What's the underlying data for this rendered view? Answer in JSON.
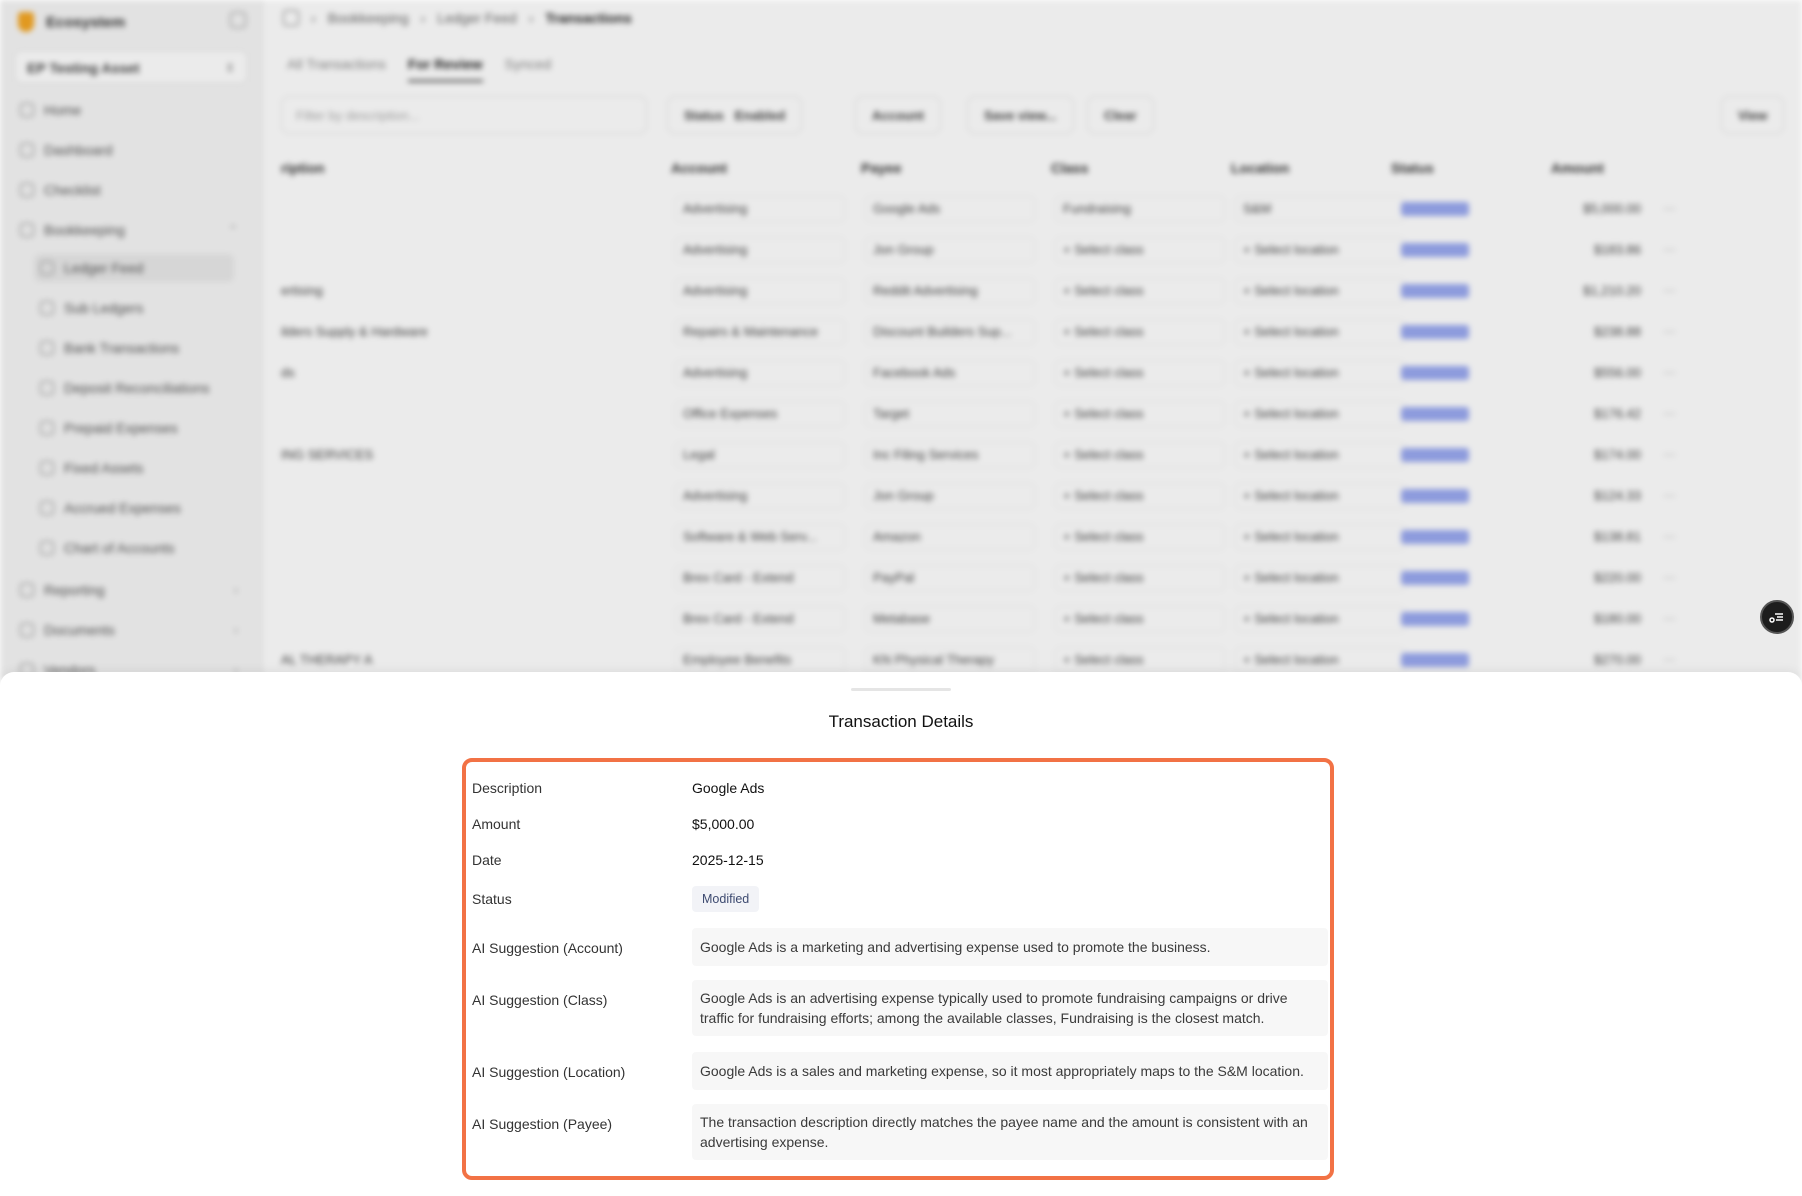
{
  "sidebar": {
    "brand": "Ecosystem",
    "org": "EP Testing Asset",
    "items": [
      {
        "label": "Home"
      },
      {
        "label": "Dashboard"
      },
      {
        "label": "Checklist"
      },
      {
        "label": "Bookkeeping"
      },
      {
        "label": "Ledger Feed"
      },
      {
        "label": "Sub Ledgers"
      },
      {
        "label": "Bank Transactions"
      },
      {
        "label": "Deposit Reconciliations"
      },
      {
        "label": "Prepaid Expenses"
      },
      {
        "label": "Fixed Assets"
      },
      {
        "label": "Accrued Expenses"
      },
      {
        "label": "Chart of Accounts"
      },
      {
        "label": "Reporting"
      },
      {
        "label": "Documents"
      },
      {
        "label": "Vendors"
      }
    ]
  },
  "breadcrumb": {
    "a": "Bookkeeping",
    "b": "Ledger Feed",
    "c": "Transactions"
  },
  "tabs": [
    "All Transactions",
    "For Review",
    "Synced"
  ],
  "filters": {
    "search_placeholder": "Filter by description...",
    "status": "Status",
    "status_value": "Enabled",
    "account": "Account",
    "save_view": "Save view...",
    "clear": "Clear",
    "view": "View"
  },
  "table": {
    "columns": [
      "ription",
      "Account",
      "Payee",
      "Class",
      "Location",
      "Status",
      "Amount"
    ],
    "rows": [
      {
        "desc": "",
        "account": "Advertising",
        "payee": "Google Ads",
        "class": "Fundraising",
        "location": "S&M",
        "amount": "$5,000.00"
      },
      {
        "desc": "",
        "account": "Advertising",
        "payee": "Jon Group",
        "class": "+ Select class",
        "location": "+ Select location",
        "amount": "$183.86"
      },
      {
        "desc": "ertising",
        "account": "Advertising",
        "payee": "Reddit Advertising",
        "class": "+ Select class",
        "location": "+ Select location",
        "amount": "$1,210.20"
      },
      {
        "desc": "ilders Supply & Hardware",
        "account": "Repairs & Maintenance",
        "payee": "Discount Builders Sup...",
        "class": "+ Select class",
        "location": "+ Select location",
        "amount": "$238.88"
      },
      {
        "desc": "ds",
        "account": "Advertising",
        "payee": "Facebook Ads",
        "class": "+ Select class",
        "location": "+ Select location",
        "amount": "$556.00"
      },
      {
        "desc": "",
        "account": "Office Expenses",
        "payee": "Target",
        "class": "+ Select class",
        "location": "+ Select location",
        "amount": "$176.42"
      },
      {
        "desc": "ING SERVICES",
        "account": "Legal",
        "payee": "Inc Filing Services",
        "class": "+ Select class",
        "location": "+ Select location",
        "amount": "$174.00"
      },
      {
        "desc": "",
        "account": "Advertising",
        "payee": "Jon Group",
        "class": "+ Select class",
        "location": "+ Select location",
        "amount": "$124.33"
      },
      {
        "desc": "",
        "account": "Software & Web Serv...",
        "payee": "Amazon",
        "class": "+ Select class",
        "location": "+ Select location",
        "amount": "$138.81"
      },
      {
        "desc": "",
        "account": "Brex Card - Extend",
        "payee": "PayPal",
        "class": "+ Select class",
        "location": "+ Select location",
        "amount": "$220.00"
      },
      {
        "desc": "",
        "account": "Brex Card - Extend",
        "payee": "Metabase",
        "class": "+ Select class",
        "location": "+ Select location",
        "amount": "$180.00"
      },
      {
        "desc": "AL THERAPY A",
        "account": "Employee Benefits",
        "payee": "KN Physical Therapy",
        "class": "+ Select class",
        "location": "+ Select location",
        "amount": "$270.00"
      }
    ]
  },
  "drawer": {
    "title": "Transaction Details",
    "fields": {
      "description_label": "Description",
      "description_value": "Google Ads",
      "amount_label": "Amount",
      "amount_value": "$5,000.00",
      "date_label": "Date",
      "date_value": "2025-12-15",
      "status_label": "Status",
      "status_value": "Modified",
      "ai_account_label": "AI Suggestion (Account)",
      "ai_account_value": "Google Ads is a marketing and advertising expense used to promote the business.",
      "ai_class_label": "AI Suggestion (Class)",
      "ai_class_value": "Google Ads is an advertising expense typically used to promote fundraising campaigns or drive traffic for fundraising efforts; among the available classes, Fundraising is the closest match.",
      "ai_location_label": "AI Suggestion (Location)",
      "ai_location_value": "Google Ads is a sales and marketing expense, so it most appropriately maps to the S&M location.",
      "ai_payee_label": "AI Suggestion (Payee)",
      "ai_payee_value": "The transaction description directly matches the payee name and the amount is consistent with an advertising expense."
    }
  },
  "colors": {
    "highlight_border": "#f27245",
    "status_pill": "#9aa9f0",
    "badge_bg": "#f2f3f7"
  }
}
